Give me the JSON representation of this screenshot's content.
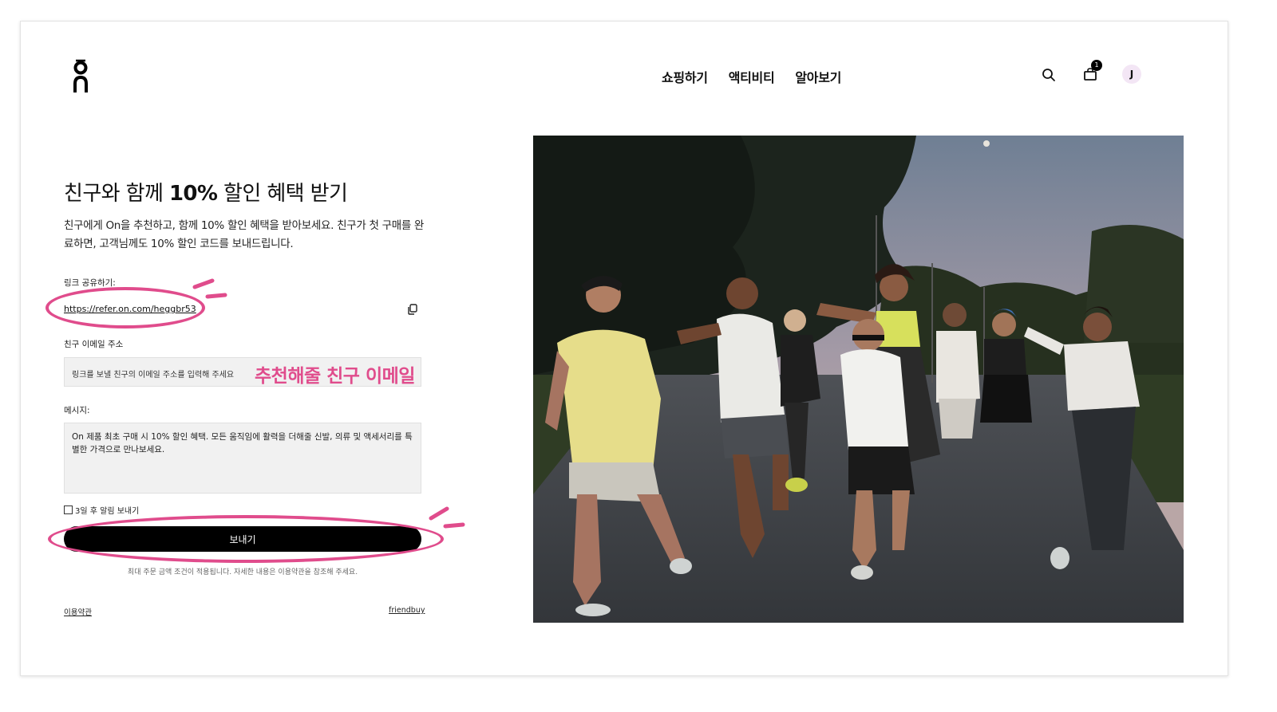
{
  "header": {
    "nav": [
      "쇼핑하기",
      "액티비티",
      "알아보기"
    ],
    "cart_count": "1",
    "avatar_initial": "J"
  },
  "main": {
    "title_before": "친구와 함께 ",
    "title_bold": "10%",
    "title_after": " 할인 혜택 받기",
    "description": "친구에게 On을 추천하고, 함께 10% 할인 혜택을 받아보세요. 친구가 첫 구매를 완료하면, 고객님께도 10% 할인 코드를 보내드립니다.",
    "share_label": "링크 공유하기:",
    "share_url": "https://refer.on.com/heggbr53",
    "email_label": "친구 이메일 주소",
    "email_placeholder": "링크를 보낼 친구의 이메일 주소를 입력해 주세요",
    "email_annotation": "추천해줄 친구 이메일",
    "message_label": "메시지:",
    "message_text": "On 제품 최초 구매 시 10% 할인 혜택. 모든 움직임에 활력을 더해줄 신발, 의류 및 액세서리를 특별한 가격으로 만나보세요.",
    "reminder_label": "3일 후 알림 보내기",
    "send_label": "보내기",
    "fineprint": "최대 주문 금액 조건이 적용됩니다. 자세한 내용은 이용약관을 참조해 주세요.",
    "terms_link": "이용약관",
    "friendbuy_link": "friendbuy"
  },
  "colors": {
    "annotation_pink": "#e04c8c",
    "button_black": "#000000",
    "field_bg": "#f1f1f1"
  }
}
